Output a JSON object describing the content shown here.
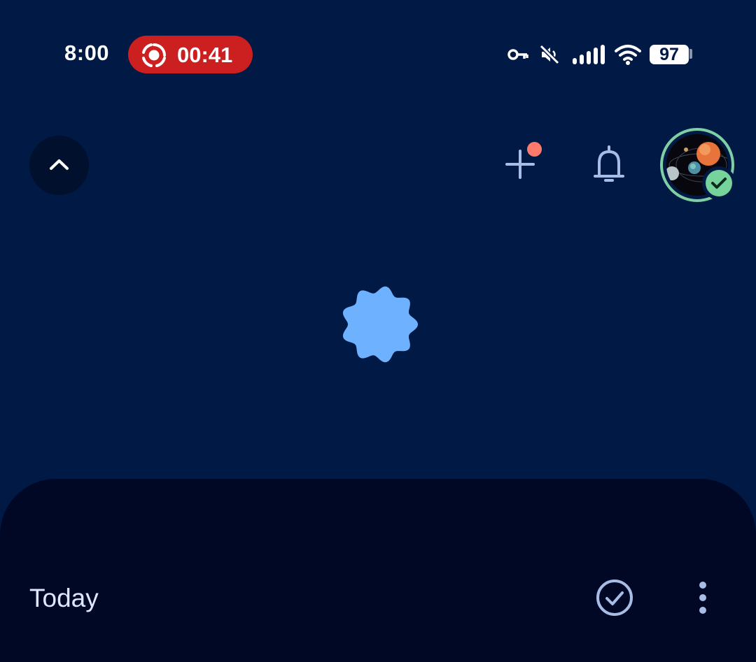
{
  "status_bar": {
    "time": "8:00",
    "recording": {
      "elapsed": "00:41",
      "color": "#cc1f1f"
    },
    "icons": [
      "vpn-key-icon",
      "mute-icon",
      "signal-icon",
      "wifi-icon"
    ],
    "battery": "97"
  },
  "header": {
    "icons": [
      "collapse-chevron-up-icon",
      "add-icon",
      "bell-icon"
    ],
    "add_has_notification_dot": true,
    "notification_dot_color": "#ff7a6b",
    "avatar": {
      "status": "check-badge-icon",
      "ring_color": "#7ed0a4"
    }
  },
  "loading": {
    "icon": "loading-blob-icon",
    "color": "#6eb2ff"
  },
  "bottom_sheet": {
    "title": "Today",
    "actions": [
      "check-circle-icon",
      "more-vert-icon"
    ]
  },
  "colors": {
    "background": "#001a45",
    "sheet": "#000825",
    "icon": "#a8bde6"
  }
}
